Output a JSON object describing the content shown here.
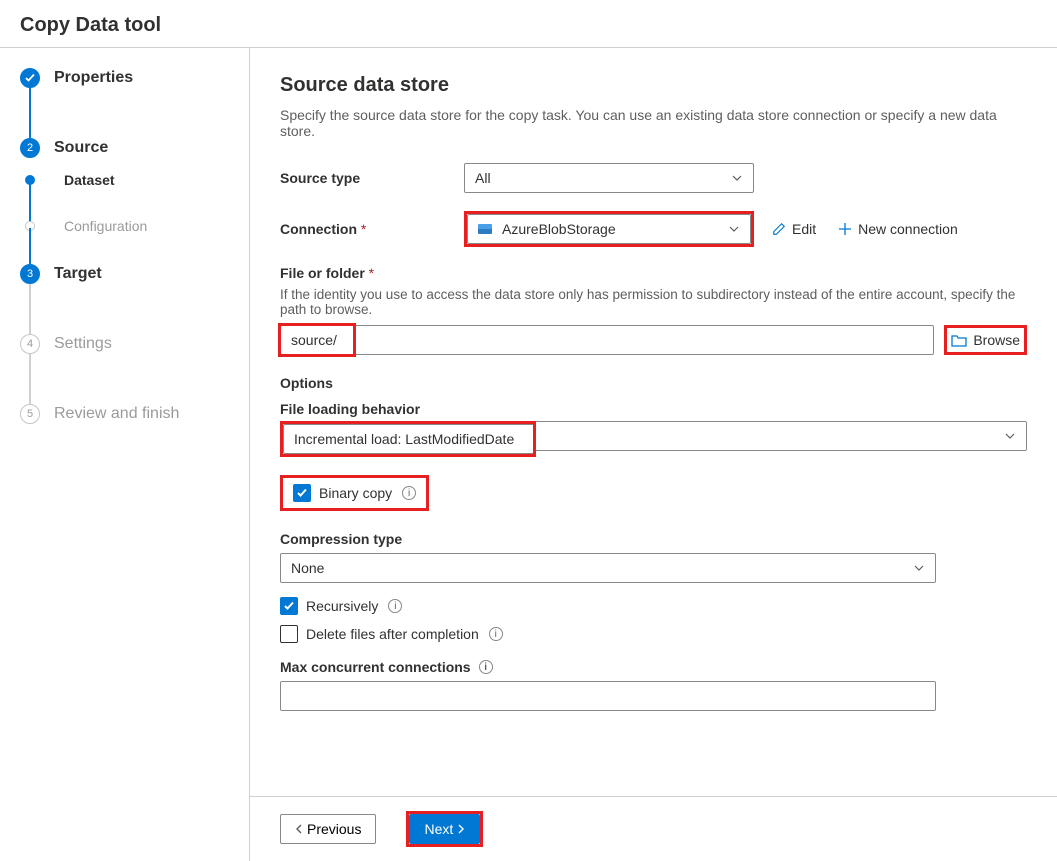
{
  "title": "Copy Data tool",
  "steps": {
    "properties": "Properties",
    "source": "Source",
    "dataset": "Dataset",
    "configuration": "Configuration",
    "target": "Target",
    "settings": "Settings",
    "review": "Review and finish",
    "nums": {
      "source": "2",
      "target": "3",
      "settings": "4",
      "review": "5"
    }
  },
  "main": {
    "heading": "Source data store",
    "desc": "Specify the source data store for the copy task. You can use an existing data store connection or specify a new data store.",
    "source_type_label": "Source type",
    "source_type_value": "All",
    "connection_label": "Connection",
    "connection_value": "AzureBlobStorage",
    "edit": "Edit",
    "new_conn": "New connection",
    "file_label": "File or folder",
    "file_help": "If the identity you use to access the data store only has permission to subdirectory instead of the entire account, specify the path to browse.",
    "file_value": "source/",
    "browse": "Browse",
    "options": "Options",
    "flb_label": "File loading behavior",
    "flb_value": "Incremental load: LastModifiedDate",
    "binary_copy": "Binary copy",
    "comp_label": "Compression type",
    "comp_value": "None",
    "recursively": "Recursively",
    "delete_after": "Delete files after completion",
    "max_conn": "Max concurrent connections",
    "max_conn_value": ""
  },
  "footer": {
    "previous": "Previous",
    "next": "Next"
  }
}
